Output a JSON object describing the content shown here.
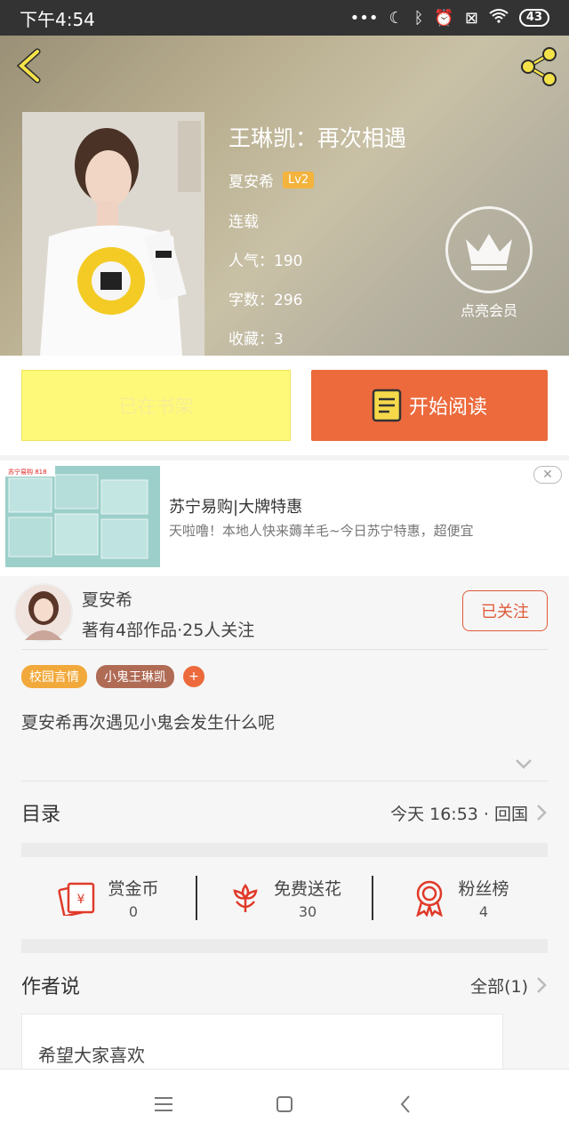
{
  "status_bar": {
    "time": "下午4:54",
    "battery": "43"
  },
  "book": {
    "title": "王琳凯：再次相遇",
    "author": "夏安希",
    "level": "Lv2",
    "status": "连载",
    "popularity": "人气：190",
    "word_count": "字数：296",
    "favorites": "收藏：3",
    "vip_label": "点亮会员"
  },
  "actions": {
    "shelf_label": "已在书架",
    "read_label": "开始阅读"
  },
  "ad": {
    "title": "苏宁易购|大牌特惠",
    "desc": "天啦噜！本地人快来薅羊毛~今日苏宁特惠，超便宜",
    "brand": "苏宁易购 818"
  },
  "author_card": {
    "name": "夏安希",
    "stats": "著有4部作品·25人关注",
    "follow_label": "已关注"
  },
  "tags": [
    "校园言情",
    "小鬼王琳凯"
  ],
  "tag_add": "+",
  "summary": "夏安希再次遇见小鬼会发生什么呢",
  "toc": {
    "title": "目录",
    "latest": "今天 16:53 · 回国"
  },
  "stats": [
    {
      "label": "赏金币",
      "value": "0",
      "icon": "red-envelope-icon"
    },
    {
      "label": "免费送花",
      "value": "30",
      "icon": "flower-icon"
    },
    {
      "label": "粉丝榜",
      "value": "4",
      "icon": "medal-icon"
    }
  ],
  "author_says": {
    "title": "作者说",
    "all_label": "全部(1)",
    "comment": "希望大家喜欢"
  },
  "colors": {
    "accent": "#ec6a3c",
    "shelf": "#fff97a",
    "tag1": "#f2a93b",
    "tag2": "#b06b55",
    "icon_red": "#e03a2a"
  }
}
